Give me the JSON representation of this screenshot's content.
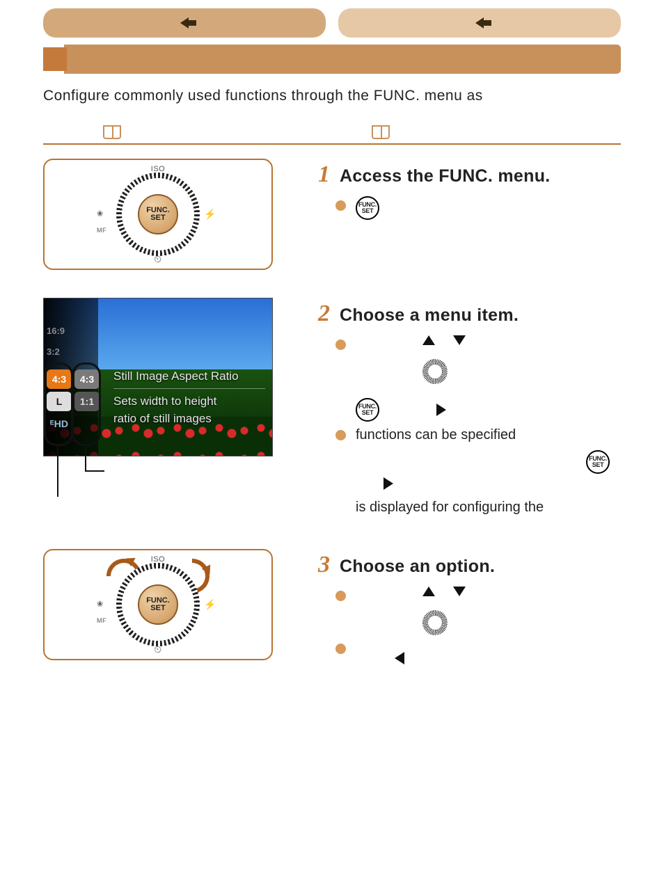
{
  "nav": {
    "back1_glyph": "←",
    "back2_glyph": "←"
  },
  "title": "",
  "intro": "Configure commonly used functions through the FUNC. menu as",
  "dial": {
    "top": "ISO",
    "left_flower": "❀",
    "left_mf": "MF",
    "right_flash": "⚡",
    "bottom_timer": "⏲",
    "center_top": "FUNC.",
    "center_bot": "SET"
  },
  "screen": {
    "dim_169": "16:9",
    "dim_32": "3:2",
    "sel_43": "4:3",
    "sel_43g": "4:3",
    "chip_L": "L",
    "chip_11": "1:1",
    "chip_hd": "ᴱHD",
    "title": "Still Image Aspect Ratio",
    "desc1": "Sets width to height",
    "desc2": "ratio of still images"
  },
  "steps": {
    "s1": {
      "num": "1",
      "title": "Access the FUNC. menu."
    },
    "s2": {
      "num": "2",
      "title": "Choose a menu item.",
      "text_a": "functions can be specified",
      "text_b": "is displayed for configuring the"
    },
    "s3": {
      "num": "3",
      "title": "Choose an option."
    }
  },
  "func_btn": {
    "top": "FUNC.",
    "bot": "SET"
  }
}
